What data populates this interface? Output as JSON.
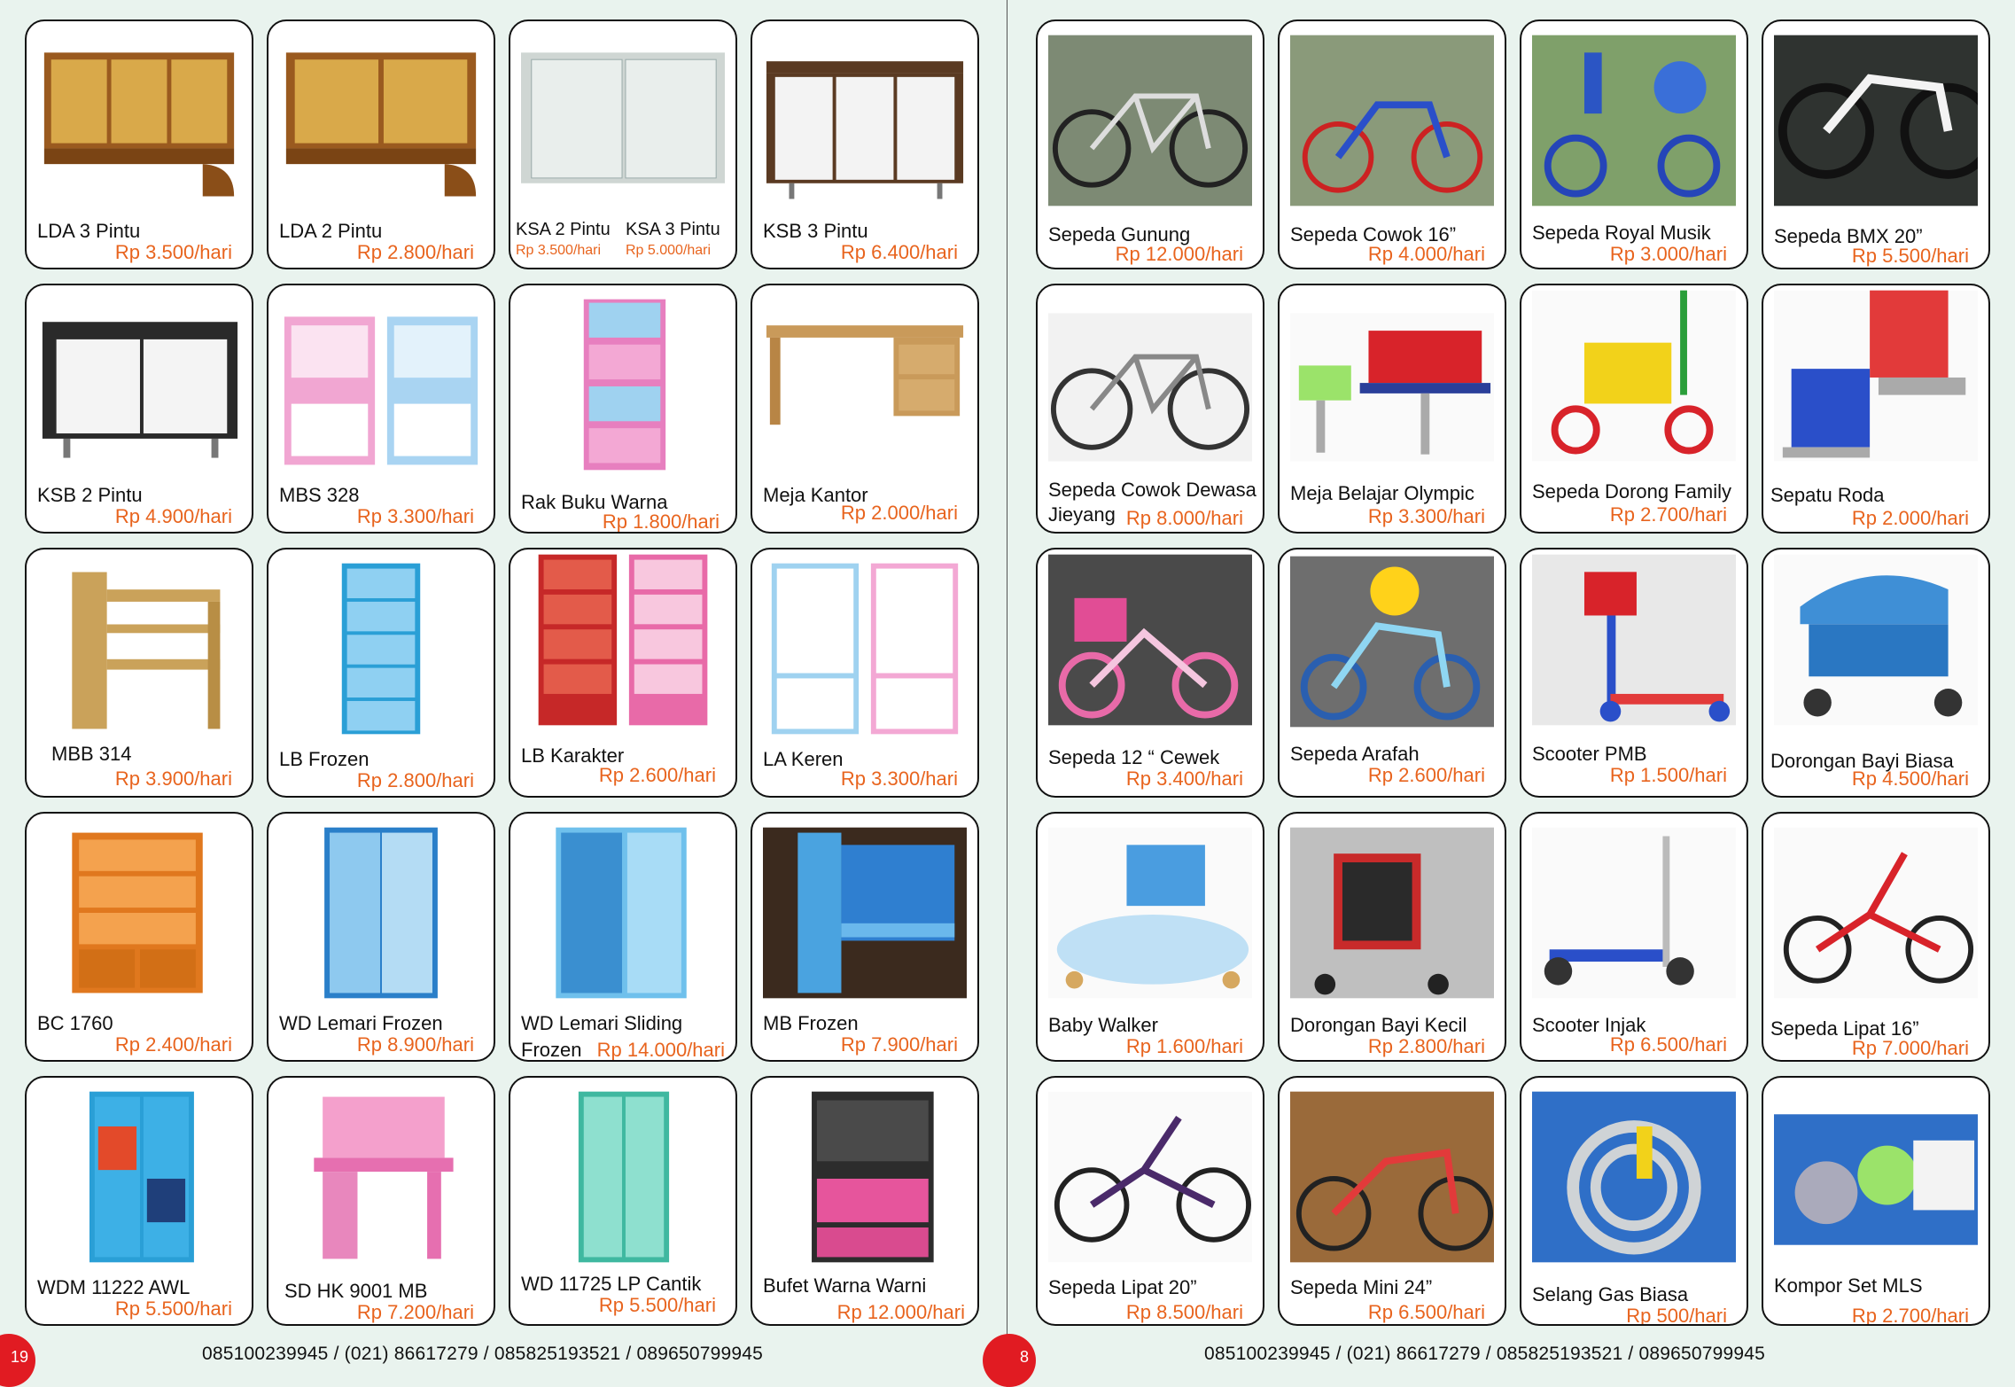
{
  "left_page": {
    "page_number": "19",
    "footer": "085100239945 / (021) 86617279 / 085825193521 / 089650799945",
    "items": [
      {
        "name": "LDA 3 Pintu",
        "price": "Rp 3.500/hari"
      },
      {
        "name": "LDA 2 Pintu",
        "price": "Rp 2.800/hari"
      },
      {
        "name_a": "KSA 2 Pintu",
        "price_a": "Rp 3.500/hari",
        "name_b": "KSA 3 Pintu",
        "price_b": "Rp 5.000/hari"
      },
      {
        "name": "KSB 3 Pintu",
        "price": "Rp 6.400/hari"
      },
      {
        "name": "KSB 2 Pintu",
        "price": "Rp 4.900/hari"
      },
      {
        "name": "MBS 328",
        "price": "Rp 3.300/hari"
      },
      {
        "name": "Rak Buku Warna",
        "price": "Rp 1.800/hari"
      },
      {
        "name": "Meja Kantor",
        "price": "Rp 2.000/hari"
      },
      {
        "name": "MBB 314",
        "price": "Rp 3.900/hari"
      },
      {
        "name": "LB Frozen",
        "price": "Rp 2.800/hari"
      },
      {
        "name": "LB Karakter",
        "price": "Rp 2.600/hari"
      },
      {
        "name": "LA Keren",
        "price": "Rp 3.300/hari"
      },
      {
        "name": "BC 1760",
        "price": "Rp 2.400/hari"
      },
      {
        "name": "WD Lemari Frozen",
        "price": "Rp 8.900/hari"
      },
      {
        "name": "WD Lemari Sliding",
        "name_line2": "Frozen",
        "price": "Rp 14.000/hari"
      },
      {
        "name": "MB Frozen",
        "price": "Rp 7.900/hari"
      },
      {
        "name": "WDM 11222 AWL",
        "price": "Rp 5.500/hari"
      },
      {
        "name": "SD HK 9001 MB",
        "price": "Rp 7.200/hari"
      },
      {
        "name": "WD 11725 LP Cantik",
        "price": "Rp 5.500/hari"
      },
      {
        "name": "Bufet Warna Warni",
        "price": "Rp 12.000/hari"
      }
    ]
  },
  "right_page": {
    "page_number": "8",
    "footer": "085100239945 / (021) 86617279 / 085825193521 / 089650799945",
    "items": [
      {
        "name": "Sepeda Gunung",
        "price": "Rp 12.000/hari"
      },
      {
        "name": "Sepeda Cowok 16”",
        "price": "Rp 4.000/hari"
      },
      {
        "name": "Sepeda Royal Musik",
        "price": "Rp 3.000/hari"
      },
      {
        "name": "Sepeda BMX 20”",
        "price": "Rp 5.500/hari"
      },
      {
        "name": "Sepeda Cowok Dewasa",
        "name_line2": "Jieyang",
        "price": "Rp 8.000/hari"
      },
      {
        "name": "Meja Belajar Olympic",
        "price": "Rp 3.300/hari"
      },
      {
        "name": "Sepeda Dorong Family",
        "price": "Rp 2.700/hari"
      },
      {
        "name": "Sepatu Roda",
        "price": "Rp 2.000/hari"
      },
      {
        "name": "Sepeda 12 “ Cewek",
        "price": "Rp 3.400/hari"
      },
      {
        "name": "Sepeda Arafah",
        "price": "Rp 2.600/hari"
      },
      {
        "name": "Scooter PMB",
        "price": "Rp 1.500/hari"
      },
      {
        "name": "Dorongan Bayi Biasa",
        "price": "Rp 4.500/hari"
      },
      {
        "name": "Baby Walker",
        "price": "Rp 1.600/hari"
      },
      {
        "name": "Dorongan Bayi Kecil",
        "price": "Rp 2.800/hari"
      },
      {
        "name": "Scooter Injak",
        "price": "Rp 6.500/hari"
      },
      {
        "name": "Sepeda Lipat 16”",
        "price": "Rp 7.000/hari"
      },
      {
        "name": "Sepeda Lipat 20”",
        "price": "Rp 8.500/hari"
      },
      {
        "name": "Sepeda Mini 24”",
        "price": "Rp 6.500/hari"
      },
      {
        "name": "Selang Gas Biasa",
        "price": "Rp 500/hari"
      },
      {
        "name": "Kompor Set MLS",
        "price": "Rp 2.700/hari"
      }
    ]
  },
  "colors": {
    "price": "#e8641e",
    "badge": "#e11b22",
    "page_bg": "#e9f3ee"
  }
}
